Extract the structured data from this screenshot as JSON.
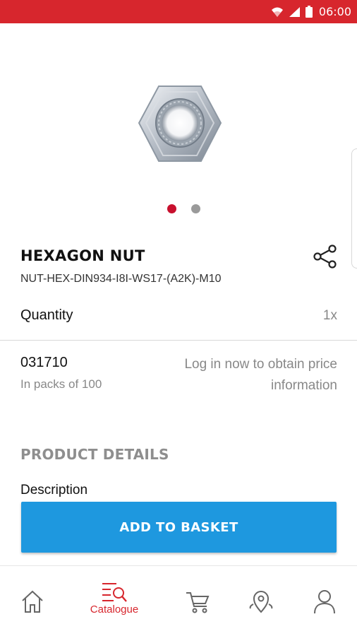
{
  "status_bar": {
    "time": "06:00"
  },
  "gallery": {
    "total_images": 2,
    "active_index": 0
  },
  "product": {
    "name": "HEXAGON NUT",
    "code": "NUT-HEX-DIN934-I8I-WS17-(A2K)-M10",
    "quantity_label": "Quantity",
    "quantity_value": "1x",
    "article_number": "031710",
    "pack_info": "In packs of 100",
    "login_hint": "Log in now to obtain price information"
  },
  "details": {
    "heading": "PRODUCT DETAILS",
    "description_label": "Description"
  },
  "actions": {
    "add_to_basket": "ADD TO BASKET"
  },
  "nav": {
    "items": [
      {
        "id": "home",
        "icon": "home-icon",
        "label": ""
      },
      {
        "id": "catalogue",
        "icon": "catalogue-search-icon",
        "label": "Catalogue",
        "active": true
      },
      {
        "id": "basket",
        "icon": "cart-icon",
        "label": ""
      },
      {
        "id": "locations",
        "icon": "location-pin-icon",
        "label": ""
      },
      {
        "id": "account",
        "icon": "user-icon",
        "label": ""
      }
    ]
  },
  "colors": {
    "brand_red": "#d7262d",
    "button_blue": "#1e98df",
    "muted_text": "#888888"
  }
}
